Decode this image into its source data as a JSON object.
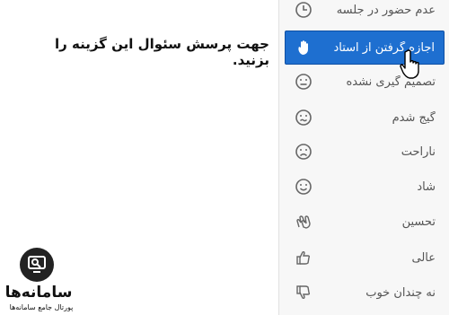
{
  "instruction": "جهت پرسش سئوال این گزینه را بزنید.",
  "menu": {
    "items": [
      {
        "label": "عدم حضور در جلسه",
        "icon": "clock-icon",
        "selected": false
      },
      {
        "label": "اجازه گرفتن از استاد",
        "icon": "raised-hand-icon",
        "selected": true
      },
      {
        "label": "تصمیم گیری نشده",
        "icon": "neutral-face-icon",
        "selected": false
      },
      {
        "label": "گیج شدم",
        "icon": "confused-face-icon",
        "selected": false
      },
      {
        "label": "ناراحت",
        "icon": "sad-face-icon",
        "selected": false
      },
      {
        "label": "شاد",
        "icon": "happy-face-icon",
        "selected": false
      },
      {
        "label": "تحسین",
        "icon": "clapping-hands-icon",
        "selected": false
      },
      {
        "label": "عالی",
        "icon": "thumbs-up-icon",
        "selected": false
      },
      {
        "label": "نه چندان خوب",
        "icon": "thumbs-down-icon",
        "selected": false
      }
    ]
  },
  "logo": {
    "name": "سامانه‌ها",
    "tagline": "پورتال جامع سامانه‌ها"
  },
  "colors": {
    "selected_bg": "#1e6fd0",
    "text": "#555555"
  }
}
